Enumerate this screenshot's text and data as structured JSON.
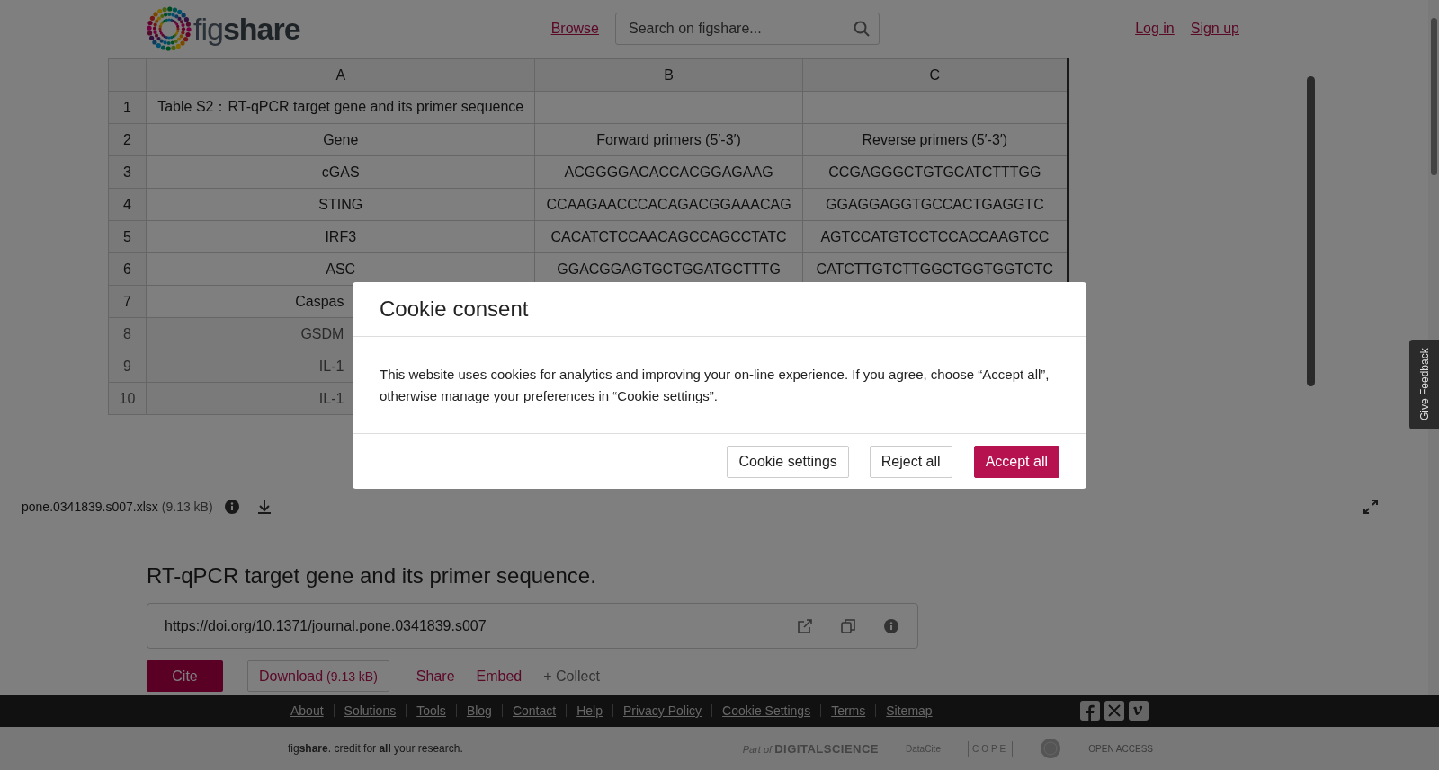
{
  "header": {
    "logo": "fig**share**",
    "nav_link": "Browse",
    "search": {
      "placeholder": "Search on figshare..."
    },
    "account_links": [
      "Log in",
      "Sign up"
    ]
  },
  "viewer": {
    "columns": [
      "A",
      "B",
      "C"
    ],
    "rows": [
      {
        "number": "1",
        "cells": [
          "Table S2：RT-qPCR target gene and its primer sequence"
        ],
        "blurred": false,
        "covered": false
      },
      {
        "number": "2",
        "cells": [
          "Gene",
          "Forward primers (5′-3′)",
          "Reverse primers (5′-3′)"
        ],
        "blurred": false,
        "covered": false
      },
      {
        "number": "3",
        "cells": [
          "cGAS",
          "ACGGGGACACCACGGAGAAG",
          "CCGAGGGCTGTGCATCTTTGG"
        ],
        "blurred": false,
        "covered": false
      },
      {
        "number": "4",
        "cells": [
          "STING",
          "CCAAGAACCCACAGACGGAAACAG",
          "GGAGGAGGTGCCACTGAGGTC"
        ],
        "blurred": false,
        "covered": false
      },
      {
        "number": "5",
        "cells": [
          "IRF3",
          "CACATCTCCAACAGCCAGCCTATC",
          "AGTCCATGTCCTCCACCAAGTCC"
        ],
        "blurred": false,
        "covered": false
      },
      {
        "number": "6",
        "cells": [
          "ASC",
          "GGACGGAGTGCTGGATGCTTTG",
          "CATCTTGTCTTGGCTGGTGGTCTC"
        ],
        "blurred": false,
        "covered": false
      },
      {
        "number": "7",
        "cells": [
          "Caspas"
        ],
        "blurred": false,
        "covered": true
      },
      {
        "number": "8",
        "cells": [
          "GSDM"
        ],
        "blurred": true,
        "covered": true
      },
      {
        "number": "9",
        "cells": [
          "IL-1"
        ],
        "blurred": true,
        "covered": true
      },
      {
        "number": "10",
        "cells": [
          "IL-1"
        ],
        "blurred": true,
        "covered": true
      }
    ],
    "file_name": "pone.0341839.s007.xlsx",
    "file_size": "(9.13 kB)"
  },
  "item": {
    "title": "RT-qPCR target gene and its primer sequence.",
    "doi": "https://doi.org/10.1371/journal.pone.0341839.s007",
    "actions": [
      {
        "kind": "primary",
        "label": "Cite"
      },
      {
        "kind": "outlined",
        "label": "Download",
        "size": "(9.13 kB)"
      },
      {
        "kind": "link",
        "label": "Share"
      },
      {
        "kind": "link",
        "label": "Embed"
      },
      {
        "kind": "muted",
        "label": "+ Collect"
      }
    ]
  },
  "footer": {
    "links": [
      "About",
      "Solutions",
      "Tools",
      "Blog",
      "Contact",
      "Help",
      "Privacy Policy",
      "Cookie Settings",
      "Terms",
      "Sitemap"
    ],
    "tagline": "fig**share**. credit for **all** your research.",
    "partners": [
      {
        "kind": "digital-science",
        "prefix": "Part of",
        "label": "DIGITALSCIENCE"
      },
      {
        "kind": "datacite",
        "label": "DataCite"
      },
      {
        "kind": "cope",
        "label": "COPE"
      },
      {
        "kind": "seal"
      },
      {
        "kind": "open-access",
        "label": "OPEN ACCESS"
      }
    ]
  },
  "feedback_tab": "Give Feedback",
  "cookie_dialog": {
    "title": "Cookie consent",
    "body": "This website uses cookies for analytics and improving your on-line experience. If you agree, choose “Accept all”, otherwise manage your preferences in “Cookie settings”.",
    "buttons": [
      {
        "kind": "secondary",
        "label": "Cookie settings"
      },
      {
        "kind": "secondary",
        "label": "Reject all"
      },
      {
        "kind": "primary",
        "label": "Accept all"
      }
    ]
  }
}
